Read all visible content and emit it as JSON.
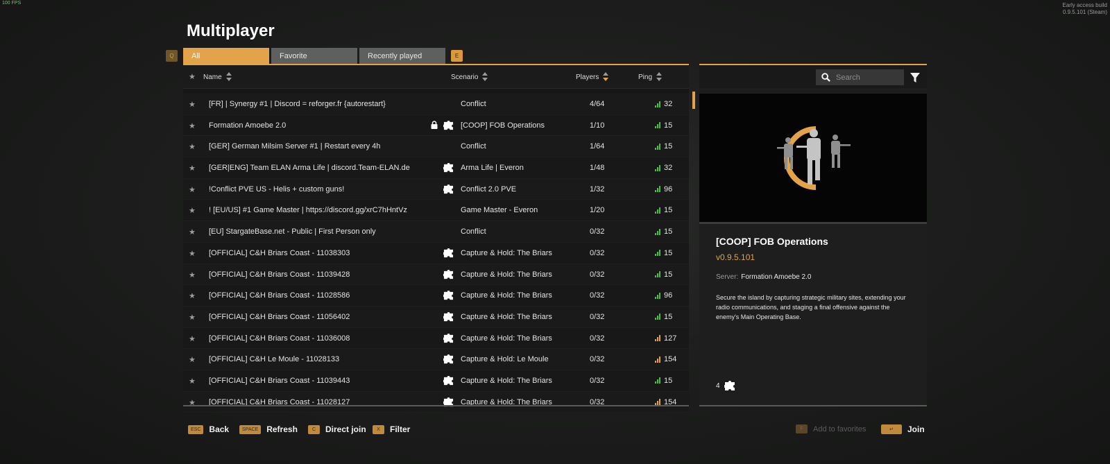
{
  "hud": {
    "fps": "100 FPS",
    "build_line1": "Early access build",
    "build_line2": "0.9.5.101 (Steam)"
  },
  "title": "Multiplayer",
  "tabs": {
    "q_key": "Q",
    "e_key": "E",
    "all": "All",
    "favorite": "Favorite",
    "recent": "Recently played"
  },
  "columns": {
    "name": "Name",
    "scenario": "Scenario",
    "players": "Players",
    "ping": "Ping"
  },
  "servers": [
    {
      "name": "[FR] | Synergy #1 | Discord = reforger.fr {autorestart}",
      "scenario": "Conflict",
      "players": "4/64",
      "ping": "32",
      "lock": false,
      "mod": false,
      "pingColor": "green"
    },
    {
      "name": "Formation Amoebe 2.0",
      "scenario": "[COOP] FOB Operations",
      "players": "1/10",
      "ping": "15",
      "lock": true,
      "mod": true,
      "pingColor": "green"
    },
    {
      "name": "[GER] German Milsim Server #1 | Restart every 4h",
      "scenario": "Conflict",
      "players": "1/64",
      "ping": "15",
      "lock": false,
      "mod": false,
      "pingColor": "green"
    },
    {
      "name": "[GER|ENG] Team ELAN Arma Life | discord.Team-ELAN.de",
      "scenario": "Arma Life | Everon",
      "players": "1/48",
      "ping": "32",
      "lock": false,
      "mod": true,
      "pingColor": "green"
    },
    {
      "name": "!Conflict PVE US - Helis + custom guns!",
      "scenario": "Conflict 2.0 PVE",
      "players": "1/32",
      "ping": "96",
      "lock": false,
      "mod": true,
      "pingColor": "green"
    },
    {
      "name": "! [EU/US] #1 Game Master | https://discord.gg/xrC7hHntVz",
      "scenario": "Game Master - Everon",
      "players": "1/20",
      "ping": "15",
      "lock": false,
      "mod": false,
      "pingColor": "green"
    },
    {
      "name": "[EU] StargateBase.net - Public | First Person only",
      "scenario": "Conflict",
      "players": "0/32",
      "ping": "15",
      "lock": false,
      "mod": false,
      "pingColor": "green"
    },
    {
      "name": "[OFFICIAL] C&H Briars Coast - 11038303",
      "scenario": "Capture & Hold: The Briars",
      "players": "0/32",
      "ping": "15",
      "lock": false,
      "mod": true,
      "pingColor": "green"
    },
    {
      "name": "[OFFICIAL] C&H Briars Coast - 11039428",
      "scenario": "Capture & Hold: The Briars",
      "players": "0/32",
      "ping": "15",
      "lock": false,
      "mod": true,
      "pingColor": "green"
    },
    {
      "name": "[OFFICIAL] C&H Briars Coast - 11028586",
      "scenario": "Capture & Hold: The Briars",
      "players": "0/32",
      "ping": "96",
      "lock": false,
      "mod": true,
      "pingColor": "green"
    },
    {
      "name": "[OFFICIAL] C&H Briars Coast - 11056402",
      "scenario": "Capture & Hold: The Briars",
      "players": "0/32",
      "ping": "15",
      "lock": false,
      "mod": true,
      "pingColor": "green"
    },
    {
      "name": "[OFFICIAL] C&H Briars Coast - 11036008",
      "scenario": "Capture & Hold: The Briars",
      "players": "0/32",
      "ping": "127",
      "lock": false,
      "mod": true,
      "pingColor": "yellow"
    },
    {
      "name": "[OFFICIAL] C&H Le Moule - 11028133",
      "scenario": "Capture & Hold: Le Moule",
      "players": "0/32",
      "ping": "154",
      "lock": false,
      "mod": true,
      "pingColor": "yellow"
    },
    {
      "name": "[OFFICIAL] C&H Briars Coast - 11039443",
      "scenario": "Capture & Hold: The Briars",
      "players": "0/32",
      "ping": "15",
      "lock": false,
      "mod": true,
      "pingColor": "green"
    },
    {
      "name": "[OFFICIAL] C&H Briars Coast - 11028127",
      "scenario": "Capture & Hold: The Briars",
      "players": "0/32",
      "ping": "154",
      "lock": false,
      "mod": true,
      "pingColor": "yellow"
    }
  ],
  "search": {
    "placeholder": "Search"
  },
  "details": {
    "title": "[COOP] FOB Operations",
    "version": "v0.9.5.101",
    "server_label": "Server:",
    "server_name": "Formation Amoebe 2.0",
    "description": "Secure the island by capturing strategic military sites, extending your radio communications, and staging a final offensive against the enemy's Main Operating Base.",
    "mod_count": "4"
  },
  "footer": {
    "back_key": "ESC",
    "back": "Back",
    "refresh_key": "SPACE",
    "refresh": "Refresh",
    "direct_key": "C",
    "direct": "Direct join",
    "filter_key": "X",
    "filter": "Filter",
    "fav_key": "F",
    "fav": "Add to favorites",
    "join_key": "↵",
    "join": "Join"
  },
  "colors": {
    "accent": "#e2a34a",
    "ping_good": "#48c04a",
    "ping_mid": "#e2a34a"
  }
}
